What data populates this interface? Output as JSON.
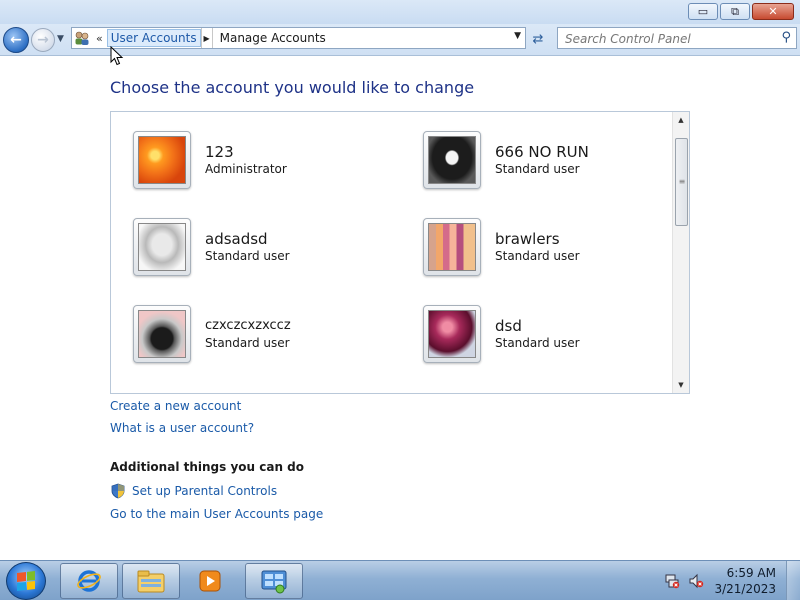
{
  "window": {
    "minimize_glyph": "▭",
    "maximize_glyph": "⧉",
    "close_glyph": "✕"
  },
  "navigation": {
    "back_icon": "back-arrow-icon",
    "forward_icon": "forward-arrow-icon",
    "address": {
      "overflow_marker": "«",
      "crumbs": [
        "User Accounts",
        "Manage Accounts"
      ]
    },
    "search_placeholder": "Search Control Panel"
  },
  "main": {
    "title": "Choose the account you would like to change",
    "accounts": [
      {
        "name": "123",
        "type": "Administrator",
        "avatar": "flower-orange"
      },
      {
        "name": "666 NO RUN",
        "type": "Standard user",
        "avatar": "dog"
      },
      {
        "name": "adsadsd",
        "type": "Standard user",
        "avatar": "robot-toy"
      },
      {
        "name": "brawlers",
        "type": "Standard user",
        "avatar": "fabric"
      },
      {
        "name": "czxczcxzxccz",
        "type": "Standard user",
        "avatar": "record-player"
      },
      {
        "name": "dsd",
        "type": "Standard user",
        "avatar": "ball"
      }
    ],
    "links": {
      "create_account": "Create a new account",
      "what_is_account": "What is a user account?"
    },
    "additional": {
      "heading": "Additional things you can do",
      "parental_controls": "Set up Parental Controls",
      "main_page": "Go to the main User Accounts page"
    }
  },
  "taskbar": {
    "time": "6:59 AM",
    "date": "3/21/2023",
    "pinned": [
      "internet-explorer-icon",
      "windows-explorer-icon",
      "media-player-icon",
      "control-panel-icon"
    ]
  },
  "colors": {
    "title_blue": "#1e3287",
    "link_blue": "#1a5aa8"
  }
}
